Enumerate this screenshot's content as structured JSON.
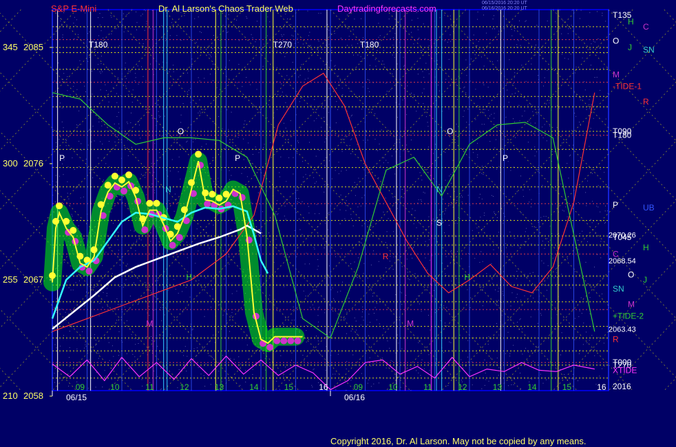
{
  "header": {
    "instrument": "S&P E-Mini",
    "author": "Dr. Al Larson's Chaos Trader Web",
    "site": "Daytradingforecasts.com",
    "stamp1": "06/15/2016 20:20 UT",
    "stamp2": "06/16/2016 20:20 UT"
  },
  "footer": {
    "copyright": "Copyright 2016, Dr. Al Larson. May not be copied by any means."
  },
  "colors": {
    "background": "#000066",
    "frame": "#0000ff",
    "grid": "#ffff00",
    "price": "#ffff33",
    "ma_fast": "#33ffff",
    "ma_slow": "#ffffff",
    "tide1": "#ff3333",
    "tide2": "#33cc33",
    "xtide": "#ff33ff",
    "band": "#00ff00"
  },
  "chart_data": {
    "type": "line",
    "y_axis": {
      "ticks": [
        {
          "value": 2085,
          "label": "2085",
          "deg": "345"
        },
        {
          "value": 2076,
          "label": "2076",
          "deg": "300"
        },
        {
          "value": 2067,
          "label": "2067",
          "deg": "255"
        },
        {
          "value": 2058,
          "label": "2058",
          "deg": "210"
        }
      ],
      "ylim": [
        2058,
        2087.5
      ]
    },
    "x_axis": {
      "date_labels": [
        "06/15",
        "06/16"
      ],
      "hour_labels": [
        "09",
        "10",
        "11",
        "12",
        "13",
        "14",
        "15",
        "16",
        "09",
        "10",
        "11",
        "12",
        "13",
        "14",
        "15",
        "16"
      ],
      "year_label": "2016",
      "sessions": 2
    },
    "price_series": {
      "name": "S&P E-Mini",
      "x": [
        0,
        0.1,
        0.2,
        0.4,
        0.6,
        0.8,
        1.0,
        1.2,
        1.4,
        1.6,
        1.8,
        2.0,
        2.2,
        2.4,
        2.6,
        2.8,
        3.0,
        3.2,
        3.4,
        3.6,
        3.8,
        4.0,
        4.2,
        4.4,
        4.6,
        4.8,
        5.0,
        5.2,
        5.4,
        5.6,
        5.8,
        6.0,
        6.2,
        6.4,
        6.6,
        6.8,
        7.0,
        7.2
      ],
      "values": [
        2066.8,
        2071.0,
        2072.2,
        2071.0,
        2070.3,
        2068.3,
        2068.0,
        2068.8,
        2072.3,
        2073.8,
        2074.5,
        2074.2,
        2074.6,
        2073.4,
        2071.2,
        2072.4,
        2072.4,
        2071.3,
        2070.0,
        2070.6,
        2071.9,
        2074.0,
        2076.2,
        2073.2,
        2073.1,
        2072.8,
        2073.1,
        2074.0,
        2073.7,
        2070.4,
        2064.5,
        2062.4,
        2062.1,
        2062.6,
        2062.6,
        2062.6,
        2062.6,
        2062.6
      ]
    },
    "ma_fast": {
      "name": "fast average",
      "x": [
        0,
        0.4,
        0.8,
        1.2,
        1.6,
        2.0,
        2.4,
        2.8,
        3.2,
        3.6,
        4.0,
        4.4,
        4.8,
        5.2,
        5.6,
        5.8,
        6.0,
        6.2
      ],
      "values": [
        2064,
        2067,
        2068,
        2068.5,
        2070,
        2071.5,
        2072.2,
        2072.1,
        2071.8,
        2071.5,
        2072.2,
        2072.6,
        2072.5,
        2072.7,
        2072.3,
        2070.5,
        2068.5,
        2067.5
      ]
    },
    "ma_slow": {
      "name": "slow average",
      "x": [
        0,
        0.6,
        1.2,
        1.8,
        2.4,
        3.0,
        3.6,
        4.2,
        4.8,
        5.4,
        5.6,
        5.8,
        6.0
      ],
      "values": [
        2063.2,
        2064.5,
        2065.8,
        2067.2,
        2068.0,
        2068.6,
        2069.2,
        2069.8,
        2070.3,
        2070.9,
        2071.2,
        2070.9,
        2070.6
      ]
    },
    "tide_red": {
      "name": "TIDE-1",
      "x": [
        0,
        1,
        2,
        3,
        4,
        5,
        5.8,
        6.5,
        7.2,
        7.8,
        8.4,
        9.0,
        9.6,
        10.2,
        10.8,
        11.4,
        12.0,
        12.6,
        13.2,
        13.8,
        14.4,
        15.0,
        15.6
      ],
      "values": [
        2063,
        2064,
        2065,
        2066,
        2067,
        2069,
        2072,
        2079,
        2082,
        2083,
        2080.5,
        2076,
        2073,
        2070,
        2067.5,
        2066,
        2067,
        2068.2,
        2066.5,
        2066,
        2068,
        2073,
        2081.5
      ]
    },
    "tide_green": {
      "name": "TIDE-2",
      "x": [
        0,
        0.8,
        1.6,
        2.4,
        3.2,
        4.0,
        4.8,
        5.6,
        6.4,
        7.2,
        8.0,
        8.8,
        9.6,
        10.4,
        11.2,
        12.0,
        12.8,
        13.6,
        14.4,
        15.2,
        15.6
      ],
      "values": [
        2081.5,
        2081,
        2079,
        2077.5,
        2078,
        2078,
        2077.8,
        2076.5,
        2072,
        2064,
        2062.5,
        2068,
        2075.5,
        2076.5,
        2073.5,
        2077.5,
        2079,
        2079.2,
        2078,
        2068,
        2063
      ]
    },
    "xtide": {
      "name": "XTIDE",
      "x": [
        0,
        0.5,
        1,
        1.5,
        2,
        2.5,
        3,
        3.5,
        4,
        4.5,
        5,
        5.5,
        6,
        6.5,
        7,
        7.5,
        8,
        8.5,
        9,
        9.5,
        10,
        10.5,
        11,
        11.5,
        12,
        12.5,
        13,
        13.5,
        14,
        14.5,
        15,
        15.6
      ],
      "values": [
        2060.5,
        2059.5,
        2060.8,
        2059.2,
        2061,
        2059.5,
        2060.6,
        2059.3,
        2060.9,
        2059.6,
        2061.1,
        2059.7,
        2060.8,
        2059.6,
        2060.4,
        2059.8,
        2058.5,
        2059.2,
        2060.6,
        2060.8,
        2059.7,
        2060.3,
        2059.4,
        2061,
        2059.5,
        2060.1,
        2059.9,
        2060.6,
        2060,
        2059.9,
        2060.4,
        2060.1
      ]
    },
    "value_labels": [
      {
        "text": "2070.26",
        "value": 2070.5
      },
      {
        "text": "2068.54",
        "value": 2068.5
      },
      {
        "text": "2063.43",
        "value": 2063.2
      }
    ],
    "right_labels": [
      {
        "text": "T135",
        "value": 2087.5,
        "color": "#ffffff"
      },
      {
        "text": "H",
        "value": 2087.0,
        "color": "#33cc33"
      },
      {
        "text": "C",
        "value": 2086.6,
        "color": "#cc33cc"
      },
      {
        "text": "O",
        "value": 2085.5,
        "color": "#ffffff"
      },
      {
        "text": "J",
        "value": 2085.0,
        "color": "#33cc33"
      },
      {
        "text": "SN",
        "value": 2084.8,
        "color": "#33cccc"
      },
      {
        "text": "M",
        "value": 2082.9,
        "color": "#cc33cc"
      },
      {
        "text": "-TIDE-1",
        "value": 2082.0,
        "color": "#ff3333"
      },
      {
        "text": "R",
        "value": 2080.8,
        "color": "#ff3333"
      },
      {
        "text": "T090",
        "value": 2078.5,
        "color": "#ffffff"
      },
      {
        "text": "T180",
        "value": 2078.2,
        "color": "#ffffff"
      },
      {
        "text": "UB",
        "value": 2072.6,
        "color": "#3355ff"
      },
      {
        "text": "P",
        "value": 2072.8,
        "color": "#ffffff"
      },
      {
        "text": "T045",
        "value": 2070.3,
        "color": "#ffffff"
      },
      {
        "text": "H",
        "value": 2069.5,
        "color": "#33cc33"
      },
      {
        "text": "C",
        "value": 2069.0,
        "color": "#cc33cc"
      },
      {
        "text": "O",
        "value": 2067.4,
        "color": "#ffffff"
      },
      {
        "text": "J",
        "value": 2067.0,
        "color": "#33cc33"
      },
      {
        "text": "SN",
        "value": 2066.3,
        "color": "#33cccc"
      },
      {
        "text": "M",
        "value": 2065.1,
        "color": "#cc33cc"
      },
      {
        "text": "+TIDE-2",
        "value": 2064.2,
        "color": "#33cc33"
      },
      {
        "text": "R",
        "value": 2062.4,
        "color": "#ff3333"
      },
      {
        "text": "T000",
        "value": 2060.6,
        "color": "#ffffff"
      },
      {
        "text": "T270",
        "value": 2060.4,
        "color": "#ffffff"
      },
      {
        "text": "XTIDE",
        "value": 2060.0,
        "color": "#ff33ff"
      }
    ],
    "vline_labels": [
      {
        "text": "T180",
        "x": 1.05,
        "value": 2085.0,
        "color": "#ffffff"
      },
      {
        "text": "T270",
        "x": 6.35,
        "value": 2085.0,
        "color": "#ffffff"
      },
      {
        "text": "T180",
        "x": 8.85,
        "value": 2085.0,
        "color": "#ffffff"
      },
      {
        "text": "O",
        "x": 3.6,
        "value": 2078.3,
        "color": "#ffffff"
      },
      {
        "text": "O",
        "x": 11.35,
        "value": 2078.3,
        "color": "#ffffff"
      },
      {
        "text": "P",
        "x": 0.2,
        "value": 2076.2,
        "color": "#ffffff"
      },
      {
        "text": "P",
        "x": 5.25,
        "value": 2076.2,
        "color": "#ffffff"
      },
      {
        "text": "P",
        "x": 12.95,
        "value": 2076.2,
        "color": "#ffffff"
      },
      {
        "text": "N",
        "x": 3.25,
        "value": 2073.8,
        "color": "#33cccc"
      },
      {
        "text": "N",
        "x": 11.05,
        "value": 2073.8,
        "color": "#33cccc"
      },
      {
        "text": "S",
        "x": 11.05,
        "value": 2071.2,
        "color": "#ffffff"
      },
      {
        "text": "M",
        "x": 2.7,
        "value": 2063.4,
        "color": "#cc33cc"
      },
      {
        "text": "M",
        "x": 10.2,
        "value": 2063.4,
        "color": "#cc33cc"
      },
      {
        "text": "R",
        "x": 9.5,
        "value": 2068.6,
        "color": "#ff3333"
      },
      {
        "text": "H",
        "x": 11.85,
        "value": 2067.0,
        "color": "#33cc33"
      },
      {
        "text": "H",
        "x": 3.85,
        "value": 2067.0,
        "color": "#33cc33"
      }
    ],
    "grid": true
  }
}
